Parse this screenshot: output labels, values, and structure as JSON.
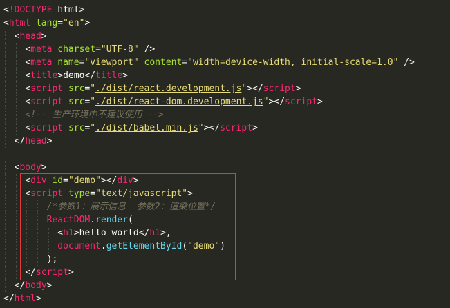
{
  "editor": {
    "lines": [
      {
        "indent": "",
        "tokens": [
          {
            "t": "punct",
            "v": "<"
          },
          {
            "t": "tag",
            "v": "!DOCTYPE"
          },
          {
            "t": "txt",
            "v": " html"
          },
          {
            "t": "punct",
            "v": ">"
          }
        ]
      },
      {
        "indent": "",
        "tokens": [
          {
            "t": "punct",
            "v": "<"
          },
          {
            "t": "tag",
            "v": "html"
          },
          {
            "t": "txt",
            "v": " "
          },
          {
            "t": "attr",
            "v": "lang"
          },
          {
            "t": "punct",
            "v": "="
          },
          {
            "t": "str",
            "v": "\"en\""
          },
          {
            "t": "punct",
            "v": ">"
          }
        ]
      },
      {
        "indent": "  ",
        "tokens": [
          {
            "t": "punct",
            "v": "<"
          },
          {
            "t": "tag",
            "v": "head"
          },
          {
            "t": "punct",
            "v": ">"
          }
        ]
      },
      {
        "indent": "    ",
        "tokens": [
          {
            "t": "punct",
            "v": "<"
          },
          {
            "t": "tag",
            "v": "meta"
          },
          {
            "t": "txt",
            "v": " "
          },
          {
            "t": "attr",
            "v": "charset"
          },
          {
            "t": "punct",
            "v": "="
          },
          {
            "t": "str",
            "v": "\"UTF-8\""
          },
          {
            "t": "txt",
            "v": " "
          },
          {
            "t": "punct",
            "v": "/>"
          }
        ]
      },
      {
        "indent": "    ",
        "tokens": [
          {
            "t": "punct",
            "v": "<"
          },
          {
            "t": "tag",
            "v": "meta"
          },
          {
            "t": "txt",
            "v": " "
          },
          {
            "t": "attr",
            "v": "name"
          },
          {
            "t": "punct",
            "v": "="
          },
          {
            "t": "str",
            "v": "\"viewport\""
          },
          {
            "t": "txt",
            "v": " "
          },
          {
            "t": "attr",
            "v": "content"
          },
          {
            "t": "punct",
            "v": "="
          },
          {
            "t": "str",
            "v": "\"width=device-width, initial-scale=1.0\""
          },
          {
            "t": "txt",
            "v": " "
          },
          {
            "t": "punct",
            "v": "/>"
          }
        ]
      },
      {
        "indent": "    ",
        "tokens": [
          {
            "t": "punct",
            "v": "<"
          },
          {
            "t": "tag",
            "v": "title"
          },
          {
            "t": "punct",
            "v": ">"
          },
          {
            "t": "txt",
            "v": "demo"
          },
          {
            "t": "punct",
            "v": "</"
          },
          {
            "t": "tag",
            "v": "title"
          },
          {
            "t": "punct",
            "v": ">"
          }
        ]
      },
      {
        "indent": "    ",
        "tokens": [
          {
            "t": "punct",
            "v": "<"
          },
          {
            "t": "tag",
            "v": "script"
          },
          {
            "t": "txt",
            "v": " "
          },
          {
            "t": "attr",
            "v": "src"
          },
          {
            "t": "punct",
            "v": "="
          },
          {
            "t": "str",
            "v": "\""
          },
          {
            "t": "str-link",
            "v": "./dist/react.development.js"
          },
          {
            "t": "str",
            "v": "\""
          },
          {
            "t": "punct",
            "v": "></"
          },
          {
            "t": "tag",
            "v": "script"
          },
          {
            "t": "punct",
            "v": ">"
          }
        ]
      },
      {
        "indent": "    ",
        "tokens": [
          {
            "t": "punct",
            "v": "<"
          },
          {
            "t": "tag",
            "v": "script"
          },
          {
            "t": "txt",
            "v": " "
          },
          {
            "t": "attr",
            "v": "src"
          },
          {
            "t": "punct",
            "v": "="
          },
          {
            "t": "str",
            "v": "\""
          },
          {
            "t": "str-link",
            "v": "./dist/react-dom.development.js"
          },
          {
            "t": "str",
            "v": "\""
          },
          {
            "t": "punct",
            "v": "></"
          },
          {
            "t": "tag",
            "v": "script"
          },
          {
            "t": "punct",
            "v": ">"
          }
        ]
      },
      {
        "indent": "    ",
        "tokens": [
          {
            "t": "comment",
            "v": "<!-- 生产环境中不建议使用 -->"
          }
        ]
      },
      {
        "indent": "    ",
        "tokens": [
          {
            "t": "punct",
            "v": "<"
          },
          {
            "t": "tag",
            "v": "script"
          },
          {
            "t": "txt",
            "v": " "
          },
          {
            "t": "attr",
            "v": "src"
          },
          {
            "t": "punct",
            "v": "="
          },
          {
            "t": "str",
            "v": "\""
          },
          {
            "t": "str-link",
            "v": "./dist/babel.min.js"
          },
          {
            "t": "str",
            "v": "\""
          },
          {
            "t": "punct",
            "v": "></"
          },
          {
            "t": "tag",
            "v": "script"
          },
          {
            "t": "punct",
            "v": ">"
          }
        ]
      },
      {
        "indent": "  ",
        "tokens": [
          {
            "t": "punct",
            "v": "</"
          },
          {
            "t": "tag",
            "v": "head"
          },
          {
            "t": "punct",
            "v": ">"
          }
        ]
      },
      {
        "indent": "",
        "tokens": []
      },
      {
        "indent": "  ",
        "tokens": [
          {
            "t": "punct",
            "v": "<"
          },
          {
            "t": "tag",
            "v": "body"
          },
          {
            "t": "punct",
            "v": ">"
          }
        ]
      },
      {
        "indent": "    ",
        "tokens": [
          {
            "t": "punct",
            "v": "<"
          },
          {
            "t": "tag",
            "v": "div"
          },
          {
            "t": "txt",
            "v": " "
          },
          {
            "t": "attr",
            "v": "id"
          },
          {
            "t": "punct",
            "v": "="
          },
          {
            "t": "str",
            "v": "\"demo\""
          },
          {
            "t": "punct",
            "v": "></"
          },
          {
            "t": "tag",
            "v": "div"
          },
          {
            "t": "punct",
            "v": ">"
          }
        ]
      },
      {
        "indent": "    ",
        "tokens": [
          {
            "t": "punct",
            "v": "<"
          },
          {
            "t": "tag",
            "v": "script"
          },
          {
            "t": "txt",
            "v": " "
          },
          {
            "t": "attr",
            "v": "type"
          },
          {
            "t": "punct",
            "v": "="
          },
          {
            "t": "str",
            "v": "\"text/javascript\""
          },
          {
            "t": "punct",
            "v": ">"
          }
        ]
      },
      {
        "indent": "        ",
        "tokens": [
          {
            "t": "comment",
            "v": "/*参数1：展示信息  参数2：渲染位置*/"
          }
        ]
      },
      {
        "indent": "        ",
        "tokens": [
          {
            "t": "tag",
            "v": "ReactDOM"
          },
          {
            "t": "txt",
            "v": "."
          },
          {
            "t": "fn",
            "v": "render"
          },
          {
            "t": "txt",
            "v": "("
          }
        ]
      },
      {
        "indent": "          ",
        "tokens": [
          {
            "t": "punct",
            "v": "<"
          },
          {
            "t": "tag",
            "v": "h1"
          },
          {
            "t": "punct",
            "v": ">"
          },
          {
            "t": "txt",
            "v": "hello world"
          },
          {
            "t": "punct",
            "v": "</"
          },
          {
            "t": "tag",
            "v": "h1"
          },
          {
            "t": "punct",
            "v": ">"
          },
          {
            "t": "txt",
            "v": ","
          }
        ]
      },
      {
        "indent": "          ",
        "tokens": [
          {
            "t": "tag",
            "v": "document"
          },
          {
            "t": "txt",
            "v": "."
          },
          {
            "t": "fn",
            "v": "getElementById"
          },
          {
            "t": "txt",
            "v": "("
          },
          {
            "t": "str",
            "v": "\"demo\""
          },
          {
            "t": "txt",
            "v": ")"
          }
        ]
      },
      {
        "indent": "        ",
        "tokens": [
          {
            "t": "txt",
            "v": ");"
          }
        ]
      },
      {
        "indent": "    ",
        "tokens": [
          {
            "t": "punct",
            "v": "</"
          },
          {
            "t": "tag",
            "v": "script"
          },
          {
            "t": "punct",
            "v": ">"
          }
        ]
      },
      {
        "indent": "  ",
        "tokens": [
          {
            "t": "punct",
            "v": "</"
          },
          {
            "t": "tag",
            "v": "body"
          },
          {
            "t": "punct",
            "v": ">"
          }
        ]
      },
      {
        "indent": "",
        "tokens": [
          {
            "t": "punct",
            "v": "</"
          },
          {
            "t": "tag",
            "v": "html"
          },
          {
            "t": "punct",
            "v": ">"
          }
        ]
      }
    ]
  },
  "colors": {
    "background": "#272822",
    "tag": "#f92672",
    "attribute": "#a6e22e",
    "string": "#e6db74",
    "comment": "#75715e",
    "function": "#66d9ef",
    "highlight_border": "#e5383b"
  }
}
